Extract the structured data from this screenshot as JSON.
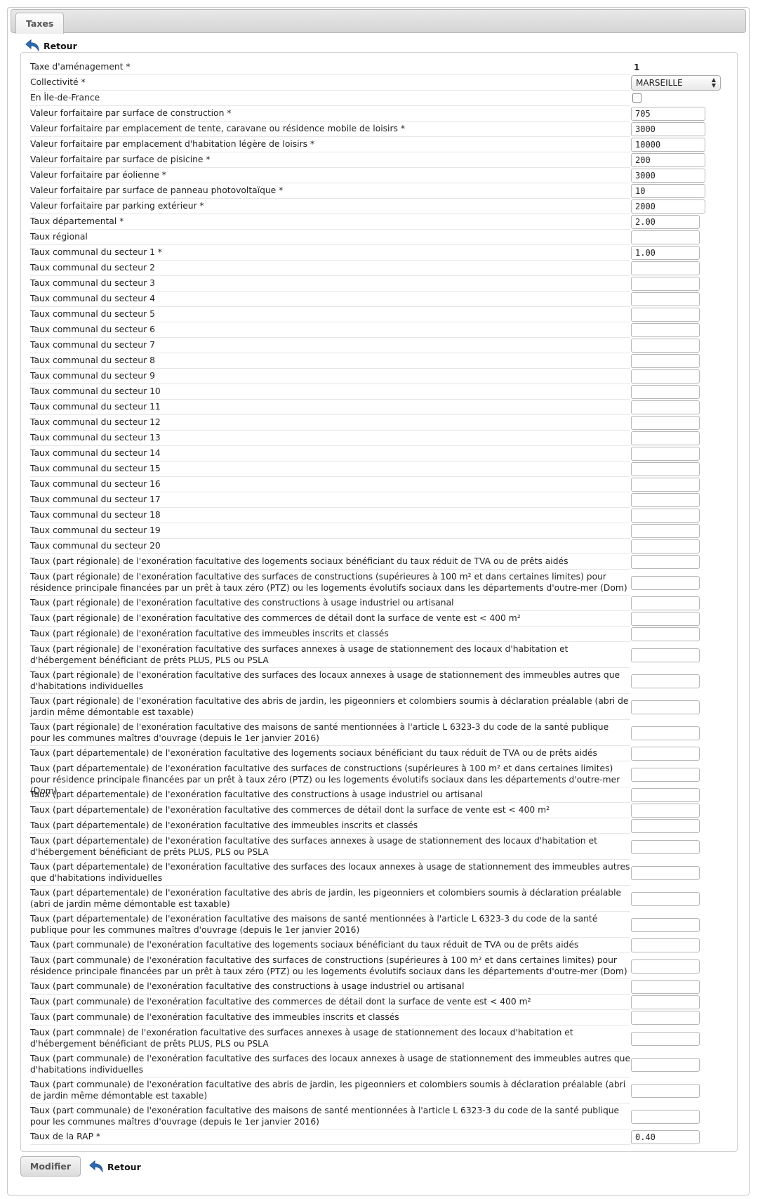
{
  "tab": {
    "label": "Taxes"
  },
  "retour_label": "Retour",
  "submit_label": "Modifier",
  "fields": [
    {
      "label": "Taxe d'aménagement *",
      "kind": "text",
      "value": "1"
    },
    {
      "label": "Collectivité *",
      "kind": "select",
      "value": "MARSEILLE"
    },
    {
      "label": "En Île-de-France",
      "kind": "checkbox",
      "checked": false
    },
    {
      "label": "Valeur forfaitaire par surface de construction *",
      "kind": "input-wide",
      "value": "705"
    },
    {
      "label": "Valeur forfaitaire par emplacement de tente, caravane ou résidence mobile de loisirs *",
      "kind": "input-wide",
      "value": "3000"
    },
    {
      "label": "Valeur forfaitaire par emplacement d'habitation légère de loisirs *",
      "kind": "input-wide",
      "value": "10000"
    },
    {
      "label": "Valeur forfaitaire par surface de pisicine *",
      "kind": "input-wide",
      "value": "200"
    },
    {
      "label": "Valeur forfaitaire par éolienne *",
      "kind": "input-wide",
      "value": "3000"
    },
    {
      "label": "Valeur forfaitaire par surface de panneau photovoltaïque *",
      "kind": "input-wide",
      "value": "10"
    },
    {
      "label": "Valeur forfaitaire par parking extérieur *",
      "kind": "input-wide",
      "value": "2000"
    },
    {
      "label": "Taux départemental *",
      "kind": "input",
      "value": "2.00"
    },
    {
      "label": "Taux régional",
      "kind": "input",
      "value": ""
    },
    {
      "label": "Taux communal du secteur 1 *",
      "kind": "input",
      "value": "1.00"
    },
    {
      "label": "Taux communal du secteur 2",
      "kind": "input",
      "value": ""
    },
    {
      "label": "Taux communal du secteur 3",
      "kind": "input",
      "value": ""
    },
    {
      "label": "Taux communal du secteur 4",
      "kind": "input",
      "value": ""
    },
    {
      "label": "Taux communal du secteur 5",
      "kind": "input",
      "value": ""
    },
    {
      "label": "Taux communal du secteur 6",
      "kind": "input",
      "value": ""
    },
    {
      "label": "Taux communal du secteur 7",
      "kind": "input",
      "value": ""
    },
    {
      "label": "Taux communal du secteur 8",
      "kind": "input",
      "value": ""
    },
    {
      "label": "Taux communal du secteur 9",
      "kind": "input",
      "value": ""
    },
    {
      "label": "Taux communal du secteur 10",
      "kind": "input",
      "value": ""
    },
    {
      "label": "Taux communal du secteur 11",
      "kind": "input",
      "value": ""
    },
    {
      "label": "Taux communal du secteur 12",
      "kind": "input",
      "value": ""
    },
    {
      "label": "Taux communal du secteur 13",
      "kind": "input",
      "value": ""
    },
    {
      "label": "Taux communal du secteur 14",
      "kind": "input",
      "value": ""
    },
    {
      "label": "Taux communal du secteur 15",
      "kind": "input",
      "value": ""
    },
    {
      "label": "Taux communal du secteur 16",
      "kind": "input",
      "value": ""
    },
    {
      "label": "Taux communal du secteur 17",
      "kind": "input",
      "value": ""
    },
    {
      "label": "Taux communal du secteur 18",
      "kind": "input",
      "value": ""
    },
    {
      "label": "Taux communal du secteur 19",
      "kind": "input",
      "value": ""
    },
    {
      "label": "Taux communal du secteur 20",
      "kind": "input",
      "value": ""
    },
    {
      "label": "Taux (part régionale) de l'exonération facultative des logements sociaux bénéficiant du taux réduit de TVA ou de prêts aidés",
      "kind": "input",
      "value": ""
    },
    {
      "label": "Taux (part régionale) de l'exonération facultative des surfaces de constructions (supérieures à 100 m² et dans certaines limites) pour résidence principale financées par un prêt à taux zéro (PTZ) ou les logements évolutifs sociaux dans les départements d'outre-mer (Dom)",
      "kind": "input",
      "value": ""
    },
    {
      "label": "Taux (part régionale) de l'exonération facultative des constructions à usage industriel ou artisanal",
      "kind": "input",
      "value": ""
    },
    {
      "label": "Taux (part régionale) de l'exonération facultative des commerces de détail dont la surface de vente est < 400 m²",
      "kind": "input",
      "value": ""
    },
    {
      "label": "Taux (part régionale) de l'exonération facultative des immeubles inscrits et classés",
      "kind": "input",
      "value": ""
    },
    {
      "label": "Taux (part régionale) de l'exonération facultative des surfaces annexes à usage de stationnement des locaux d'habitation et d'hébergement bénéficiant de prêts PLUS, PLS ou PSLA",
      "kind": "input",
      "value": ""
    },
    {
      "label": "Taux (part régionale) de l'exonération facultative des surfaces des locaux annexes à usage de stationnement des immeubles autres que d'habitations individuelles",
      "kind": "input",
      "value": ""
    },
    {
      "label": "Taux (part régionale) de l'exonération facultative des abris de jardin, les pigeonniers et colombiers soumis à déclaration préalable (abri de jardin même démontable est taxable)",
      "kind": "input",
      "value": ""
    },
    {
      "label": "Taux (part régionale) de l'exonération facultative des maisons de santé mentionnées à l'article L 6323-3 du code de la santé publique pour les communes maîtres d'ouvrage (depuis le 1er janvier 2016)",
      "kind": "input",
      "value": ""
    },
    {
      "label": "Taux (part départementale) de l'exonération facultative des logements sociaux bénéficiant du taux réduit de TVA ou de prêts aidés",
      "kind": "input",
      "value": ""
    },
    {
      "label": "Taux (part départementale) de l'exonération facultative des surfaces de constructions (supérieures à 100 m² et dans certaines limites) pour résidence principale financées par un prêt à taux zéro (PTZ) ou les logements évolutifs sociaux dans les départements d'outre-mer (Dom)",
      "kind": "input",
      "value": ""
    },
    {
      "label": "Taux (part départementale) de l'exonération facultative des constructions à usage industriel ou artisanal",
      "kind": "input",
      "value": ""
    },
    {
      "label": "Taux (part départementale) de l'exonération facultative des commerces de détail dont la surface de vente est < 400 m²",
      "kind": "input",
      "value": ""
    },
    {
      "label": "Taux (part départementale) de l'exonération facultative des immeubles inscrits et classés",
      "kind": "input",
      "value": ""
    },
    {
      "label": "Taux (part départementale) de l'exonération facultative des surfaces annexes à usage de stationnement des locaux d'habitation et d'hébergement bénéficiant de prêts PLUS, PLS ou PSLA",
      "kind": "input",
      "value": ""
    },
    {
      "label": "Taux (part départementale) de l'exonération facultative des surfaces des locaux annexes à usage de stationnement des immeubles autres que d'habitations individuelles",
      "kind": "input",
      "value": ""
    },
    {
      "label": "Taux (part départementale) de l'exonération facultative des abris de jardin, les pigeonniers et colombiers soumis à déclaration préalable (abri de jardin même démontable est taxable)",
      "kind": "input",
      "value": ""
    },
    {
      "label": "Taux (part départementale) de l'exonération facultative des maisons de santé mentionnées à l'article L 6323-3 du code de la santé publique pour les communes maîtres d'ouvrage (depuis le 1er janvier 2016)",
      "kind": "input",
      "value": ""
    },
    {
      "label": "Taux (part communale) de l'exonération facultative des logements sociaux bénéficiant du taux réduit de TVA ou de prêts aidés",
      "kind": "input",
      "value": ""
    },
    {
      "label": "Taux (part communale) de l'exonération facultative des surfaces de constructions (supérieures à 100 m² et dans certaines limites) pour résidence principale financées par un prêt à taux zéro (PTZ) ou les logements évolutifs sociaux dans les départements d'outre-mer (Dom)",
      "kind": "input",
      "value": ""
    },
    {
      "label": "Taux (part communale) de l'exonération facultative des constructions à usage industriel ou artisanal",
      "kind": "input",
      "value": ""
    },
    {
      "label": "Taux (part communale) de l'exonération facultative des commerces de détail dont la surface de vente est < 400 m²",
      "kind": "input",
      "value": ""
    },
    {
      "label": "Taux (part communale) de l'exonération facultative des immeubles inscrits et classés",
      "kind": "input",
      "value": ""
    },
    {
      "label": "Taux (part commnale) de l'exonération facultative des surfaces annexes à usage de stationnement des locaux d'habitation et d'hébergement bénéficiant de prêts PLUS, PLS ou PSLA",
      "kind": "input",
      "value": ""
    },
    {
      "label": "Taux (part communale) de l'exonération facultative des surfaces des locaux annexes à usage de stationnement des immeubles autres que d'habitations individuelles",
      "kind": "input",
      "value": ""
    },
    {
      "label": "Taux (part communale) de l'exonération facultative des abris de jardin, les pigeonniers et colombiers soumis à déclaration préalable (abri de jardin même démontable est taxable)",
      "kind": "input",
      "value": ""
    },
    {
      "label": "Taux (part communale) de l'exonération facultative des maisons de santé mentionnées à l'article L 6323-3 du code de la santé publique pour les communes maîtres d'ouvrage (depuis le 1er janvier 2016)",
      "kind": "input",
      "value": ""
    },
    {
      "label": "Taux de la RAP *",
      "kind": "input",
      "value": "0.40"
    }
  ]
}
